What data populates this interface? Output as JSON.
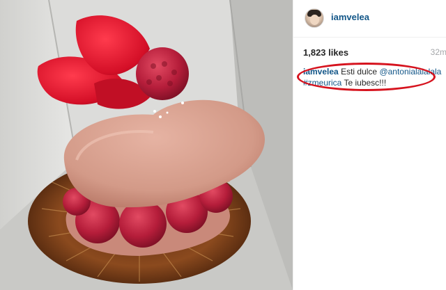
{
  "post": {
    "username": "iamvelea",
    "likes": "1,823 likes",
    "time_ago": "32m",
    "caption": {
      "author": "iamvelea",
      "text1": "Esti dulce",
      "mention": "@antonialalalala",
      "hashtag": "#zmeurica",
      "text2": "Te iubesc!!!"
    }
  },
  "photo": {
    "subject": "heart-shaped-macaron-with-raspberries-and-rose-petals"
  },
  "annotation": {
    "color": "#d6131e"
  },
  "colors": {
    "link": "#125688",
    "text": "#262626",
    "muted": "#a5a7aa"
  }
}
